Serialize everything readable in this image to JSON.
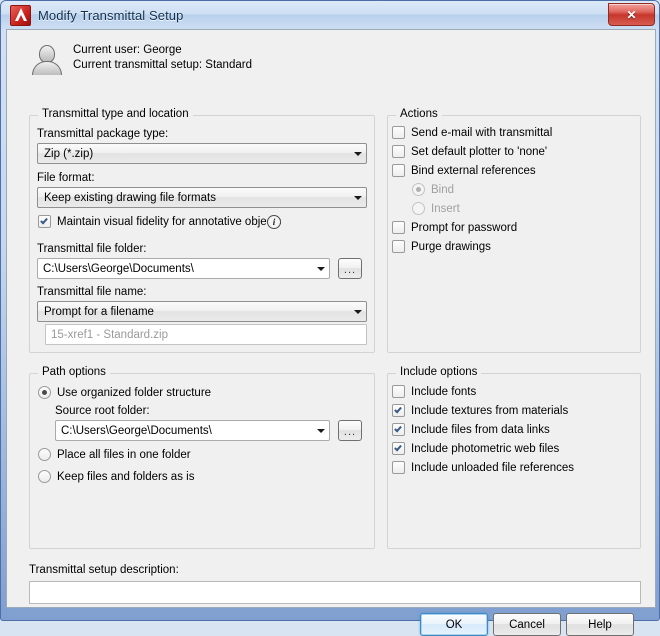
{
  "window": {
    "title": "Modify Transmittal Setup",
    "logo_icon": "autocad-logo-icon",
    "close_label": "✕"
  },
  "header": {
    "user_icon": "user-silhouette-icon",
    "current_user": "Current user: George",
    "current_setup": "Current transmittal setup: Standard"
  },
  "transmittal_group": {
    "legend": "Transmittal type and location",
    "package_type_label": "Transmittal package type:",
    "package_type_value": "Zip (*.zip)",
    "file_format_label": "File format:",
    "file_format_value": "Keep existing drawing file formats",
    "fidelity_label": "Maintain visual fidelity for annotative objects",
    "fidelity_checked": true,
    "info_icon": "info-icon",
    "info_glyph": "i",
    "file_folder_label": "Transmittal file folder:",
    "file_folder_value": "C:\\Users\\George\\Documents\\",
    "browse_folder_label": "...",
    "file_name_label": "Transmittal file name:",
    "file_name_mode": "Prompt for a filename",
    "file_name_value": "15-xref1 - Standard.zip",
    "file_name_disabled": true
  },
  "actions_group": {
    "legend": "Actions",
    "items": [
      {
        "label": "Send e-mail with transmittal",
        "checked": false,
        "disabled": false
      },
      {
        "label": "Set default plotter to 'none'",
        "checked": false,
        "disabled": false
      },
      {
        "label": "Bind external references",
        "checked": false,
        "disabled": false
      }
    ],
    "radios": [
      {
        "label": "Bind",
        "selected": true,
        "disabled": true
      },
      {
        "label": "Insert",
        "selected": false,
        "disabled": true
      }
    ],
    "items_after": [
      {
        "label": "Prompt for password",
        "checked": false,
        "disabled": false
      },
      {
        "label": "Purge drawings",
        "checked": false,
        "disabled": false
      }
    ]
  },
  "path_group": {
    "legend": "Path options",
    "option_organized": "Use organized folder structure",
    "option_organized_selected": true,
    "source_root_label": "Source root folder:",
    "source_root_value": "C:\\Users\\George\\Documents\\",
    "browse_source_label": "...",
    "option_one_folder": "Place all files in one folder",
    "option_one_folder_selected": false,
    "option_keep_as_is": "Keep files and folders as is",
    "option_keep_as_is_selected": false
  },
  "include_group": {
    "legend": "Include options",
    "items": [
      {
        "label": "Include fonts",
        "checked": false
      },
      {
        "label": "Include textures from materials",
        "checked": true
      },
      {
        "label": "Include files from data links",
        "checked": true
      },
      {
        "label": "Include photometric web files",
        "checked": true
      },
      {
        "label": "Include unloaded file references",
        "checked": false
      }
    ]
  },
  "description": {
    "label": "Transmittal setup description:",
    "value": ""
  },
  "buttons": {
    "ok": "OK",
    "cancel": "Cancel",
    "help": "Help"
  },
  "colors": {
    "accent": "#3c8bc4",
    "title_text": "#13314f",
    "close_red": "#c6372c",
    "disabled_text": "#a0a0a0"
  }
}
